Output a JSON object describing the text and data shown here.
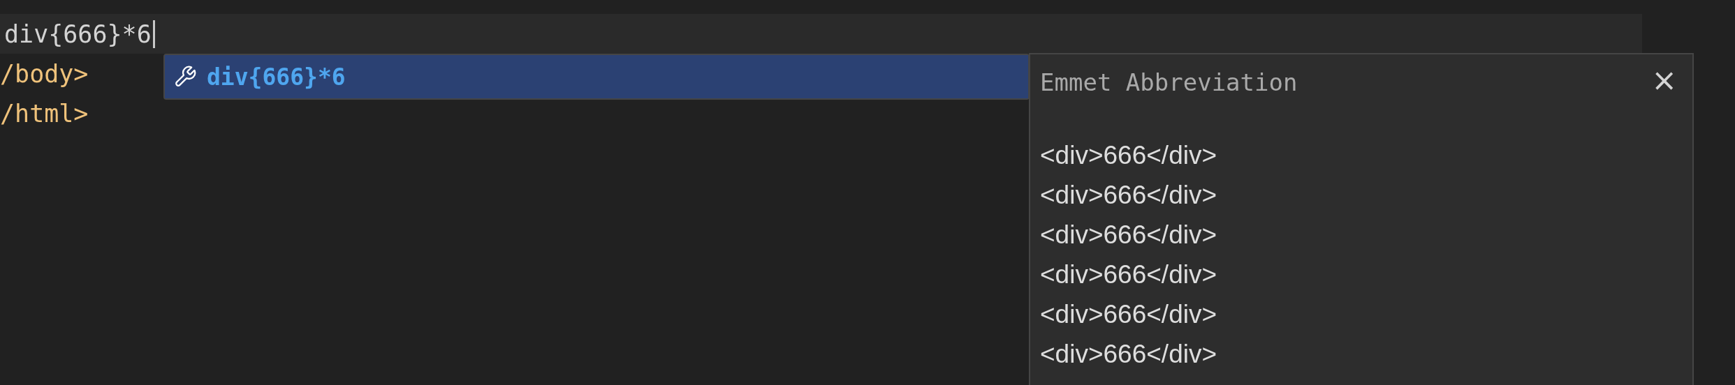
{
  "editor": {
    "lines": [
      {
        "text": "div{666}*6",
        "kind": "current"
      },
      {
        "text": "/body>",
        "kind": "tag"
      },
      {
        "text": "/html>",
        "kind": "tag"
      }
    ]
  },
  "suggest": {
    "items": [
      {
        "label": "div{666}*6",
        "selected": true
      }
    ]
  },
  "details": {
    "title": "Emmet Abbreviation",
    "close": "×",
    "preview": [
      "<div>666</div>",
      "<div>666</div>",
      "<div>666</div>",
      "<div>666</div>",
      "<div>666</div>",
      "<div>666</div>"
    ]
  }
}
